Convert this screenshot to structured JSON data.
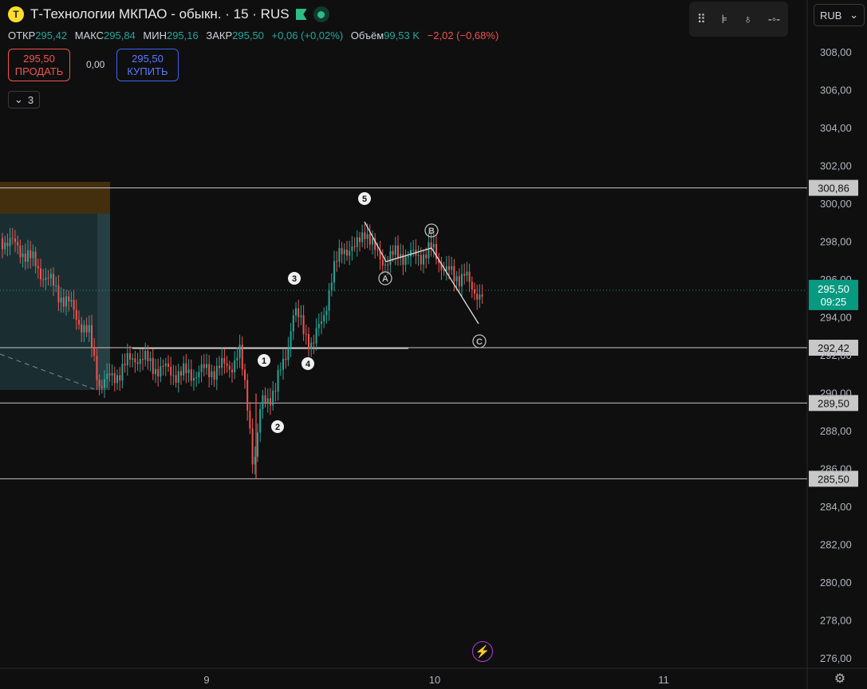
{
  "header": {
    "title": "Т-Технологии МКПАО - обыкн. · 15 · RUS",
    "logo_letter": "Т"
  },
  "ohlc": {
    "open_label": "ОТКР",
    "open": "295,42",
    "high_label": "МАКС",
    "high": "295,84",
    "low_label": "МИН",
    "low": "295,16",
    "close_label": "ЗАКР",
    "close": "295,50",
    "change": "+0,06 (+0,02%)",
    "volume_label": "Объём",
    "volume": "99,53 K",
    "day_change": "−2,02 (−0,68%)"
  },
  "trade": {
    "sell_price": "295,50",
    "sell_label": "ПРОДАТЬ",
    "spread": "0,00",
    "buy_price": "295,50",
    "buy_label": "КУПИТЬ"
  },
  "indicators": {
    "count": "3"
  },
  "currency": {
    "label": "RUB"
  },
  "colors": {
    "up": "#26a69a",
    "down": "#ef5350",
    "bg": "#0f0f0f",
    "axis_text": "#b2b5be",
    "level_line": "#c8c8c8",
    "sell": "#f05452",
    "buy": "#3f62f0",
    "current_price_bg": "#089981"
  },
  "chart_data": {
    "type": "candlestick",
    "price_axis": {
      "min": 275,
      "max": 309,
      "ticks": [
        "308,00",
        "306,00",
        "304,00",
        "302,00",
        "300,00",
        "298,00",
        "296,00",
        "294,00",
        "292,00",
        "290,00",
        "288,00",
        "286,00",
        "284,00",
        "282,00",
        "280,00",
        "278,00",
        "276,00"
      ],
      "tick_values": [
        308,
        306,
        304,
        302,
        300,
        298,
        296,
        294,
        292,
        290,
        288,
        286,
        284,
        282,
        280,
        278,
        276
      ]
    },
    "time_axis": {
      "labels": [
        "9",
        "10",
        "11"
      ]
    },
    "levels": [
      {
        "value": 300.86,
        "label": "300,86"
      },
      {
        "value": 292.42,
        "label": "292,42"
      },
      {
        "value": 289.5,
        "label": "289,50"
      },
      {
        "value": 285.5,
        "label": "285,50"
      }
    ],
    "current_price": {
      "value": 295.5,
      "label": "295,50",
      "countdown": "09:25"
    },
    "wave_labels": [
      "1",
      "2",
      "3",
      "4",
      "5",
      "A",
      "B",
      "C"
    ]
  }
}
